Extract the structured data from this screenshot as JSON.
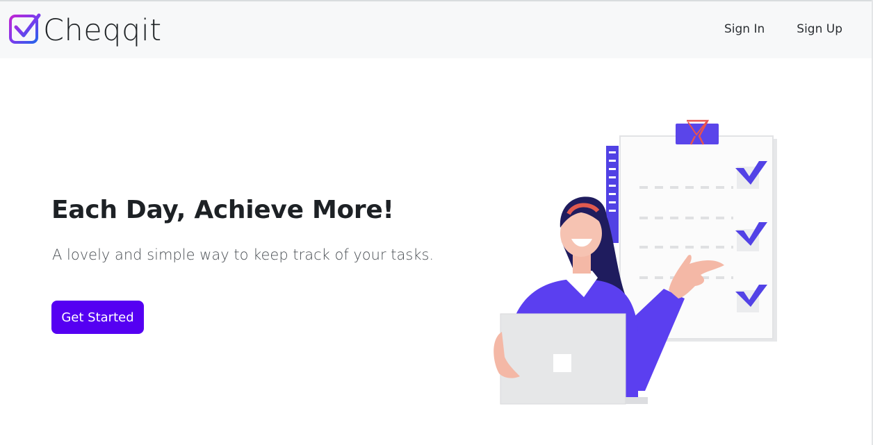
{
  "navbar": {
    "brand_name": "Cheqqit",
    "logo_icon": "check-square-icon",
    "links": [
      "Sign In",
      "Sign Up"
    ]
  },
  "hero": {
    "title": "Each Day, Achieve More!",
    "subtitle": "A lovely and simple way to keep track of your tasks.",
    "cta_label": "Get Started",
    "illustration": "woman-with-laptop-and-checklist-illustration"
  },
  "colors": {
    "accent": "#5500f2",
    "navbar_bg": "#f7f8f9",
    "illustration_purple": "#5b3ff0",
    "checkmark": "#5242e6"
  }
}
